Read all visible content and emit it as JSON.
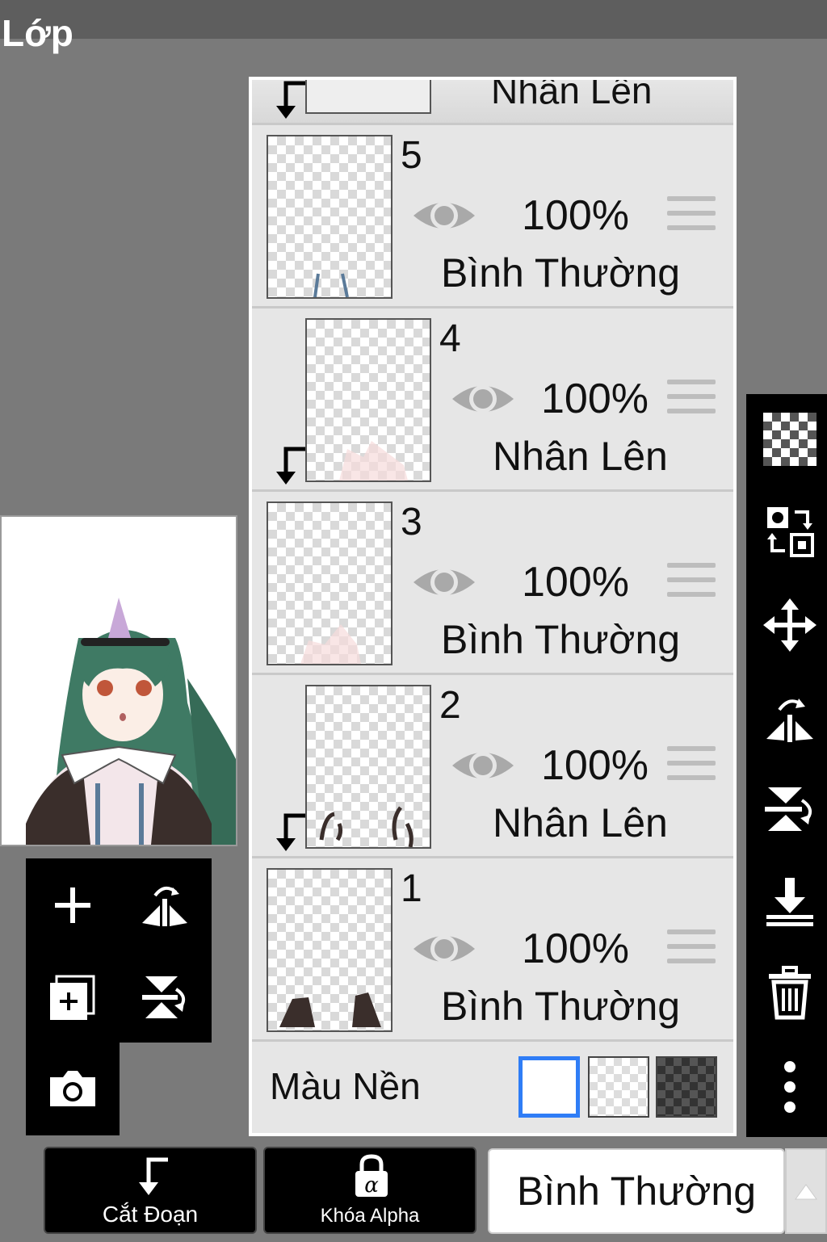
{
  "app": {
    "title": "Lớp"
  },
  "layers_partial": {
    "label": "Nhân Lên"
  },
  "layers": [
    {
      "number": "5",
      "opacity": "100%",
      "mode": "Bình Thường",
      "clipped": false
    },
    {
      "number": "4",
      "opacity": "100%",
      "mode": "Nhân Lên",
      "clipped": true
    },
    {
      "number": "3",
      "opacity": "100%",
      "mode": "Bình Thường",
      "clipped": false
    },
    {
      "number": "2",
      "opacity": "100%",
      "mode": "Nhân Lên",
      "clipped": true
    },
    {
      "number": "1",
      "opacity": "100%",
      "mode": "Bình Thường",
      "clipped": false
    }
  ],
  "background": {
    "label": "Màu Nền",
    "options": [
      "white",
      "transparent",
      "dark-checker"
    ],
    "selected": "white"
  },
  "bottom_bar": {
    "clip_label": "Cắt Đoạn",
    "alpha_lock_label": "Khóa Alpha",
    "blend_mode": "Bình Thường"
  },
  "left_tools": [
    "add-layer-icon",
    "flip-horizontal-icon",
    "add-copy-layer-icon",
    "flip-vertical-icon",
    "camera-icon"
  ],
  "right_tools": [
    "transparent-icon",
    "swap-layers-icon",
    "move-icon",
    "flip-horizontal-icon",
    "flip-vertical-icon",
    "merge-down-icon",
    "trash-icon",
    "more-icon"
  ],
  "colors": {
    "accent": "#2f7df6",
    "panel": "#e6e6e6",
    "toolbar": "#000000"
  }
}
